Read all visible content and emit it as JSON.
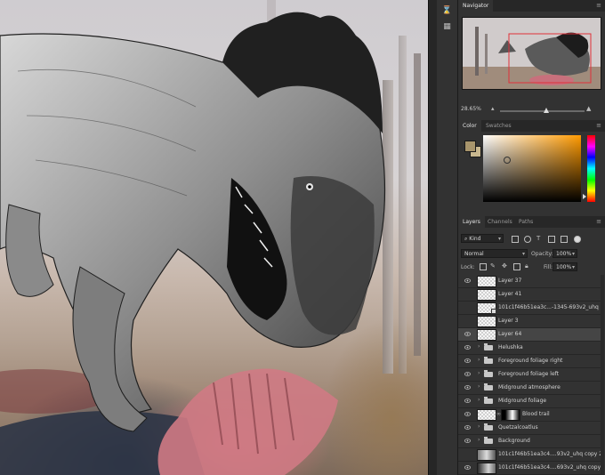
{
  "navigator": {
    "tab_label": "Navigator",
    "zoom_value": "28.65%",
    "zoom_fraction": 0.55
  },
  "color_panel": {
    "tabs": [
      "Color",
      "Swatches"
    ],
    "foreground_color": "#a8956c",
    "background_color": "#c9b88f",
    "picker_color": "#ff9a00"
  },
  "layers_panel": {
    "tabs": [
      "Layers",
      "Channels",
      "Paths"
    ],
    "filter_label": "Kind",
    "blend_mode": "Normal",
    "opacity_label": "Opacity:",
    "opacity_value": "100%",
    "lock_label": "Lock:",
    "fill_label": "Fill:",
    "fill_value": "100%",
    "layers": [
      {
        "name": "Layer 37",
        "type": "pixel",
        "visible": true,
        "selected": false
      },
      {
        "name": "Layer 41",
        "type": "pixel",
        "visible": false,
        "selected": false
      },
      {
        "name": "101c1f46b51ea3c...-1345-693v2_uhq",
        "type": "smart",
        "visible": false,
        "selected": false
      },
      {
        "name": "Layer 3",
        "type": "pixel",
        "visible": false,
        "selected": false
      },
      {
        "name": "Layer 64",
        "type": "pixel",
        "visible": true,
        "selected": true
      },
      {
        "name": "Helushka",
        "type": "group",
        "visible": true,
        "selected": false
      },
      {
        "name": "Foreground foliage right",
        "type": "group",
        "visible": true,
        "selected": false
      },
      {
        "name": "Foreground foliage left",
        "type": "group",
        "visible": true,
        "selected": false
      },
      {
        "name": "Midground atmosphere",
        "type": "group",
        "visible": true,
        "selected": false
      },
      {
        "name": "Midground foliage",
        "type": "group",
        "visible": true,
        "selected": false
      },
      {
        "name": "Blood trail",
        "type": "masked",
        "visible": true,
        "selected": false
      },
      {
        "name": "Quetzalcoatlus",
        "type": "group",
        "visible": true,
        "selected": false
      },
      {
        "name": "Background",
        "type": "group",
        "visible": true,
        "selected": false
      },
      {
        "name": "101c1f46b51ea3c4....93v2_uhq copy 2",
        "type": "photo",
        "visible": false,
        "selected": false
      },
      {
        "name": "101c1f46b51ea3c4....693v2_uhq copy",
        "type": "photo2",
        "visible": true,
        "selected": false
      }
    ]
  }
}
